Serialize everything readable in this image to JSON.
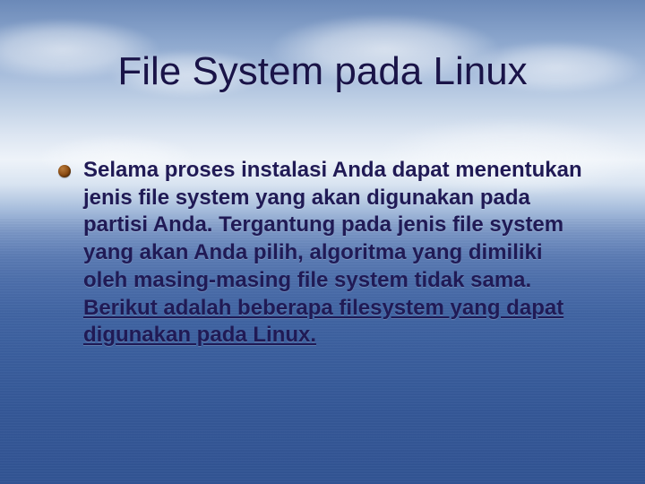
{
  "title": "File System pada Linux",
  "bullet": {
    "normal": "Selama proses instalasi Anda dapat menentukan jenis file system yang akan digunakan pada partisi Anda. Tergantung pada jenis file system yang akan Anda pilih, algoritma yang dimiliki oleh masing-masing file system tidak sama. ",
    "underlined": "Berikut adalah beberapa filesystem yang dapat digunakan pada Linux."
  },
  "bullet_color": "#8a4a10"
}
